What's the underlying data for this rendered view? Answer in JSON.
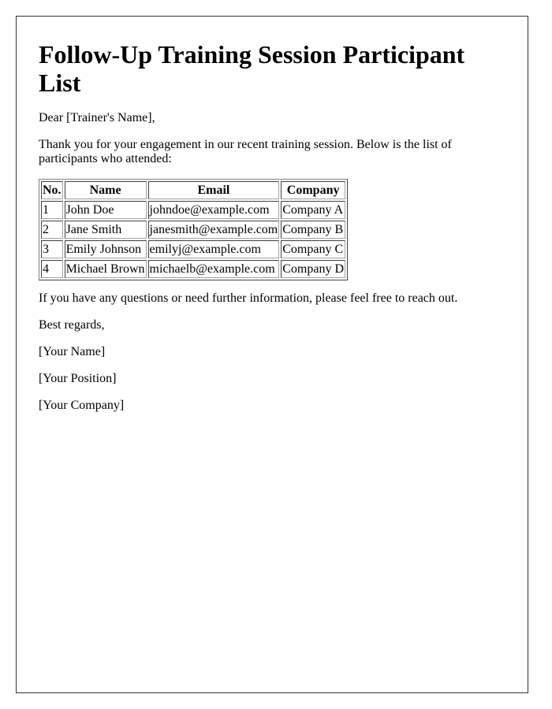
{
  "document": {
    "title": "Follow-Up Training Session Participant List",
    "greeting": "Dear [Trainer's Name],",
    "intro": "Thank you for your engagement in our recent training session. Below is the list of participants who attended:",
    "table": {
      "headers": [
        "No.",
        "Name",
        "Email",
        "Company"
      ],
      "rows": [
        [
          "1",
          "John Doe",
          "johndoe@example.com",
          "Company A"
        ],
        [
          "2",
          "Jane Smith",
          "janesmith@example.com",
          "Company B"
        ],
        [
          "3",
          "Emily Johnson",
          "emilyj@example.com",
          "Company C"
        ],
        [
          "4",
          "Michael Brown",
          "michaelb@example.com",
          "Company D"
        ]
      ]
    },
    "closing_note": "If you have any questions or need further information, please feel free to reach out.",
    "sign_off": "Best regards,",
    "sender_name": "[Your Name]",
    "sender_position": "[Your Position]",
    "sender_company": "[Your Company]"
  }
}
